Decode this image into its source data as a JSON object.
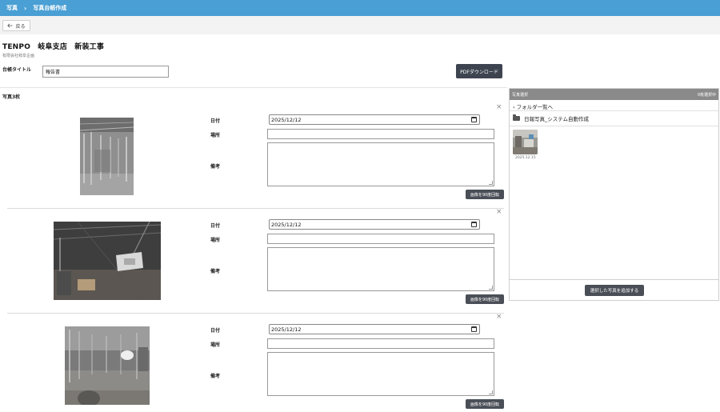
{
  "breadcrumb": {
    "root": "写真",
    "separator": "›",
    "current": "写真台帳作成"
  },
  "toolbar": {
    "back_label": "戻る",
    "back_icon": "arrow-left-icon"
  },
  "store": {
    "title": "TENPO　岐阜支店　新装工事",
    "company": "有限会社岐阜企画"
  },
  "ledger": {
    "label": "台帳タイトル",
    "value": "報告書"
  },
  "pdf_button": "PDFダウンロード",
  "photo_count": "写真3枚",
  "entries": [
    {
      "date_label": "日付",
      "date_value": "2025/12/12",
      "place_label": "場所",
      "place_value": "",
      "note_label": "備考",
      "note_value": "",
      "rotate_label": "画像を90度回転",
      "close": "×"
    },
    {
      "date_label": "日付",
      "date_value": "2025/12/12",
      "place_label": "場所",
      "place_value": "",
      "note_label": "備考",
      "note_value": "",
      "rotate_label": "画像を90度回転",
      "close": "×"
    },
    {
      "date_label": "日付",
      "date_value": "2025/12/12",
      "place_label": "場所",
      "place_value": "",
      "note_label": "備考",
      "note_value": "",
      "rotate_label": "画像を90度回転",
      "close": "×"
    }
  ],
  "panel": {
    "title": "写真選択",
    "selected_count": "0枚選択中",
    "folder_back": "‹ フォルダ一覧へ",
    "folder_name": "日報写真_システム自動作成",
    "thumbnail_date": "2025.12.15",
    "add_button": "選択した写真を追加する"
  },
  "colors": {
    "topbar": "#4a9fd4",
    "dark_button": "#3d4450",
    "panel_header": "#8a8a8a"
  }
}
